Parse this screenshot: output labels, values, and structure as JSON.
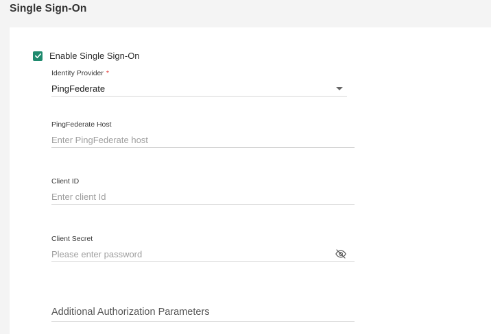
{
  "page": {
    "title": "Single Sign-On"
  },
  "sso": {
    "enable_label": "Enable Single Sign-On",
    "enabled": true,
    "identity_provider": {
      "label": "Identity Provider",
      "required_mark": "*",
      "value": "PingFederate"
    },
    "host": {
      "label": "PingFederate Host",
      "placeholder": "Enter PingFederate host",
      "value": ""
    },
    "client_id": {
      "label": "Client ID",
      "placeholder": "Enter client Id",
      "value": ""
    },
    "client_secret": {
      "label": "Client Secret",
      "placeholder": "Please enter password",
      "value": "",
      "visibility_icon": "eye-off-icon"
    },
    "additional_params": {
      "label": "Additional Authorization Parameters"
    }
  },
  "colors": {
    "accent": "#1f8a6e",
    "required": "#e53935",
    "background": "#f4f4f4",
    "card": "#ffffff"
  }
}
